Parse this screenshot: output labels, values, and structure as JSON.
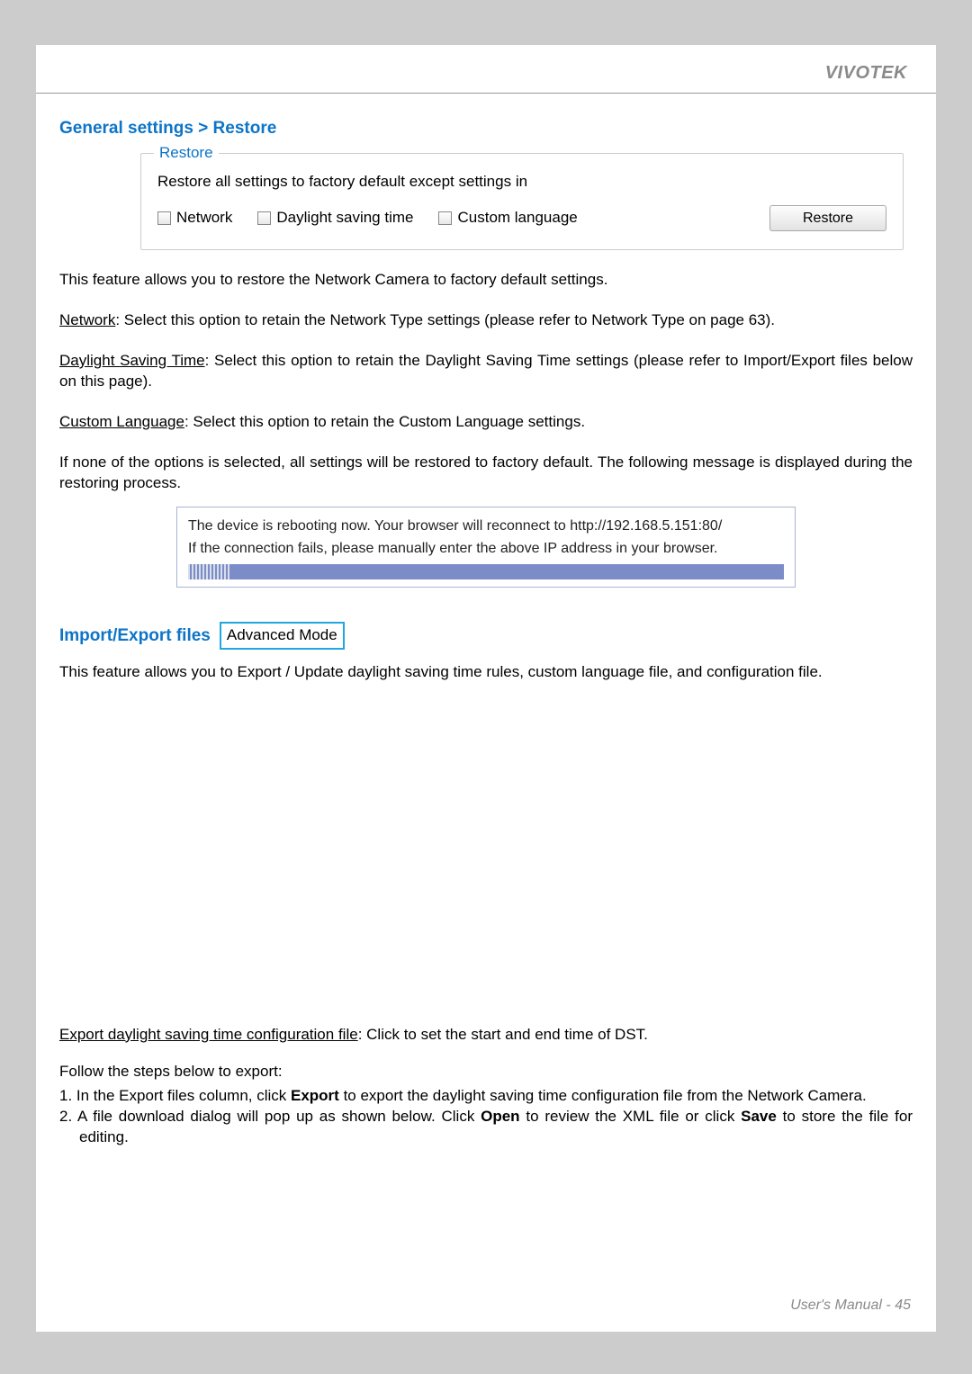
{
  "brand": "VIVOTEK",
  "section1_title": "General settings > Restore",
  "fieldset": {
    "legend": "Restore",
    "desc": "Restore all settings to factory default except settings in",
    "options": {
      "network": "Network",
      "dst": "Daylight saving time",
      "lang": "Custom language"
    },
    "button": "Restore"
  },
  "p_intro": "This feature allows you to restore the Network Camera to factory default settings.",
  "p_net_label": "Network",
  "p_net_body": ": Select this option to retain the Network Type settings (please refer to Network Type on page 63).",
  "p_dst_label": "Daylight Saving Time",
  "p_dst_body": ": Select this option to retain the Daylight Saving Time settings (please refer to Import/Export files below on this page).",
  "p_lang_label": "Custom Language",
  "p_lang_body": ": Select this option to retain the Custom Language settings.",
  "p_none": "If none of the options is selected, all settings will be restored to factory default.  The following message is displayed during the restoring process.",
  "reboot_line1": "The device is rebooting now. Your browser will reconnect to http://192.168.5.151:80/",
  "reboot_line2": "If the connection fails, please manually enter the above IP address in your browser.",
  "section2_title": "Import/Export files",
  "adv_mode": "Advanced Mode",
  "p_ie_intro": "This feature allows you to Export / Update daylight saving time rules, custom language file, and configuration file.",
  "p_export_label": "Export daylight saving time configuration file",
  "p_export_body": ": Click to set the start and end time of DST.",
  "p_follow": "Follow the steps below to export:",
  "step1_pre": "1. In the Export files column, click ",
  "step1_bold": "Export",
  "step1_post": " to export the daylight saving time configuration file from the Network Camera.",
  "step2_pre": "2. A file download dialog will pop up as shown below. Click ",
  "step2_open": "Open",
  "step2_mid": " to review the XML file or click ",
  "step2_save": "Save",
  "step2_post": " to store the file for editing.",
  "footer": "User's Manual - 45"
}
